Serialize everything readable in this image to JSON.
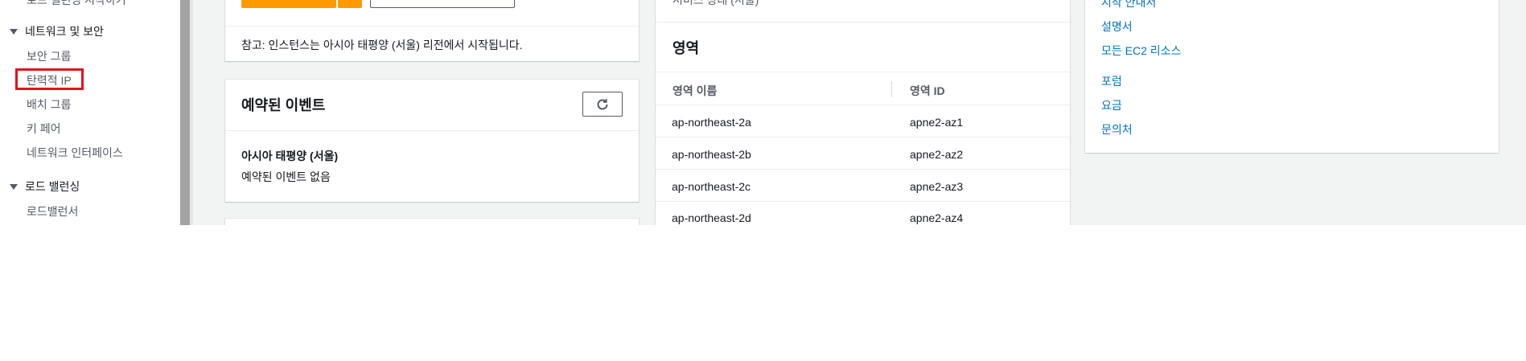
{
  "sidebar": {
    "cut_item": "로드 밸런싱 시작하기",
    "network_section": "네트워크 및 보안",
    "network_items": [
      "보안 그룹",
      "탄력적 IP",
      "배치 그룹",
      "키 페어",
      "네트워크 인터페이스"
    ],
    "lb_section": "로드 밸런싱",
    "lb_items": [
      "로드밸런서"
    ]
  },
  "launch_panel": {
    "note": "참고: 인스턴스는 아시아 태평양 (서울) 리전에서 시작됩니다."
  },
  "events_card": {
    "title": "예약된 이벤트",
    "region": "아시아 태평양 (서울)",
    "empty": "예약된 이벤트 없음"
  },
  "zones_card": {
    "cut_text": "서비스 상태 (서울)",
    "title": "영역",
    "headers": [
      "영역 이름",
      "영역 ID"
    ],
    "rows": [
      [
        "ap-northeast-2a",
        "apne2-az1"
      ],
      [
        "ap-northeast-2b",
        "apne2-az2"
      ],
      [
        "ap-northeast-2c",
        "apne2-az3"
      ],
      [
        "ap-northeast-2d",
        "apne2-az4"
      ]
    ]
  },
  "links_card": {
    "cut_link": "시작 안내서",
    "links": [
      "설명서",
      "모든 EC2 리소스",
      "포럼",
      "요금",
      "문의처"
    ]
  },
  "colors": {
    "accent_orange": "#ff9900",
    "link_blue": "#0073bb",
    "highlight_red": "#e0141e"
  }
}
